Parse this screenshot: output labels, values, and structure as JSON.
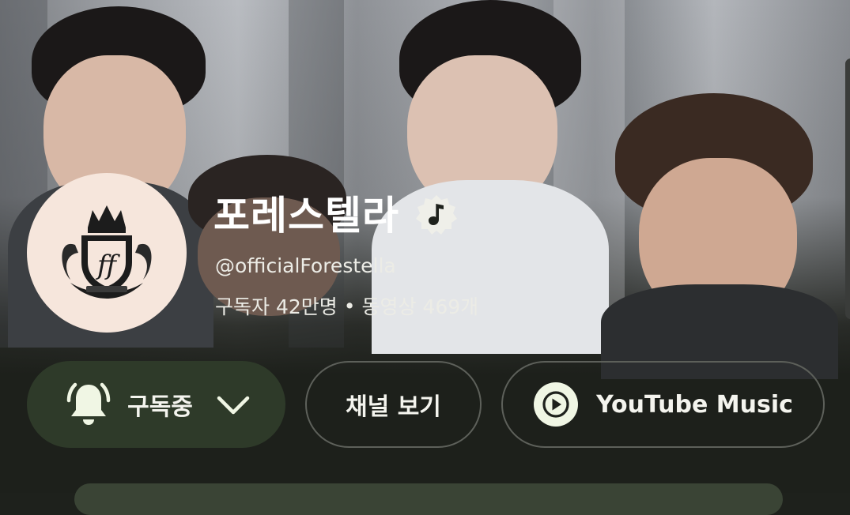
{
  "channel": {
    "name": "포레스텔라",
    "handle": "@officialForestella",
    "subscribers": "구독자 42만명",
    "separator": "•",
    "videos": "동영상 469개",
    "badge_icon": "music-note-badge-icon",
    "avatar_icon": "crest-logo"
  },
  "actions": {
    "subscribed_label": "구독중",
    "bell_icon": "bell-ringing-icon",
    "dropdown_icon": "chevron-down-icon",
    "view_channel_label": "채널 보기",
    "music_label": "YouTube Music",
    "music_icon": "youtube-music-icon"
  },
  "colors": {
    "subscribed_bg": "#2e3a29",
    "accent_light": "#f0f6e4",
    "background": "#1e211c"
  }
}
